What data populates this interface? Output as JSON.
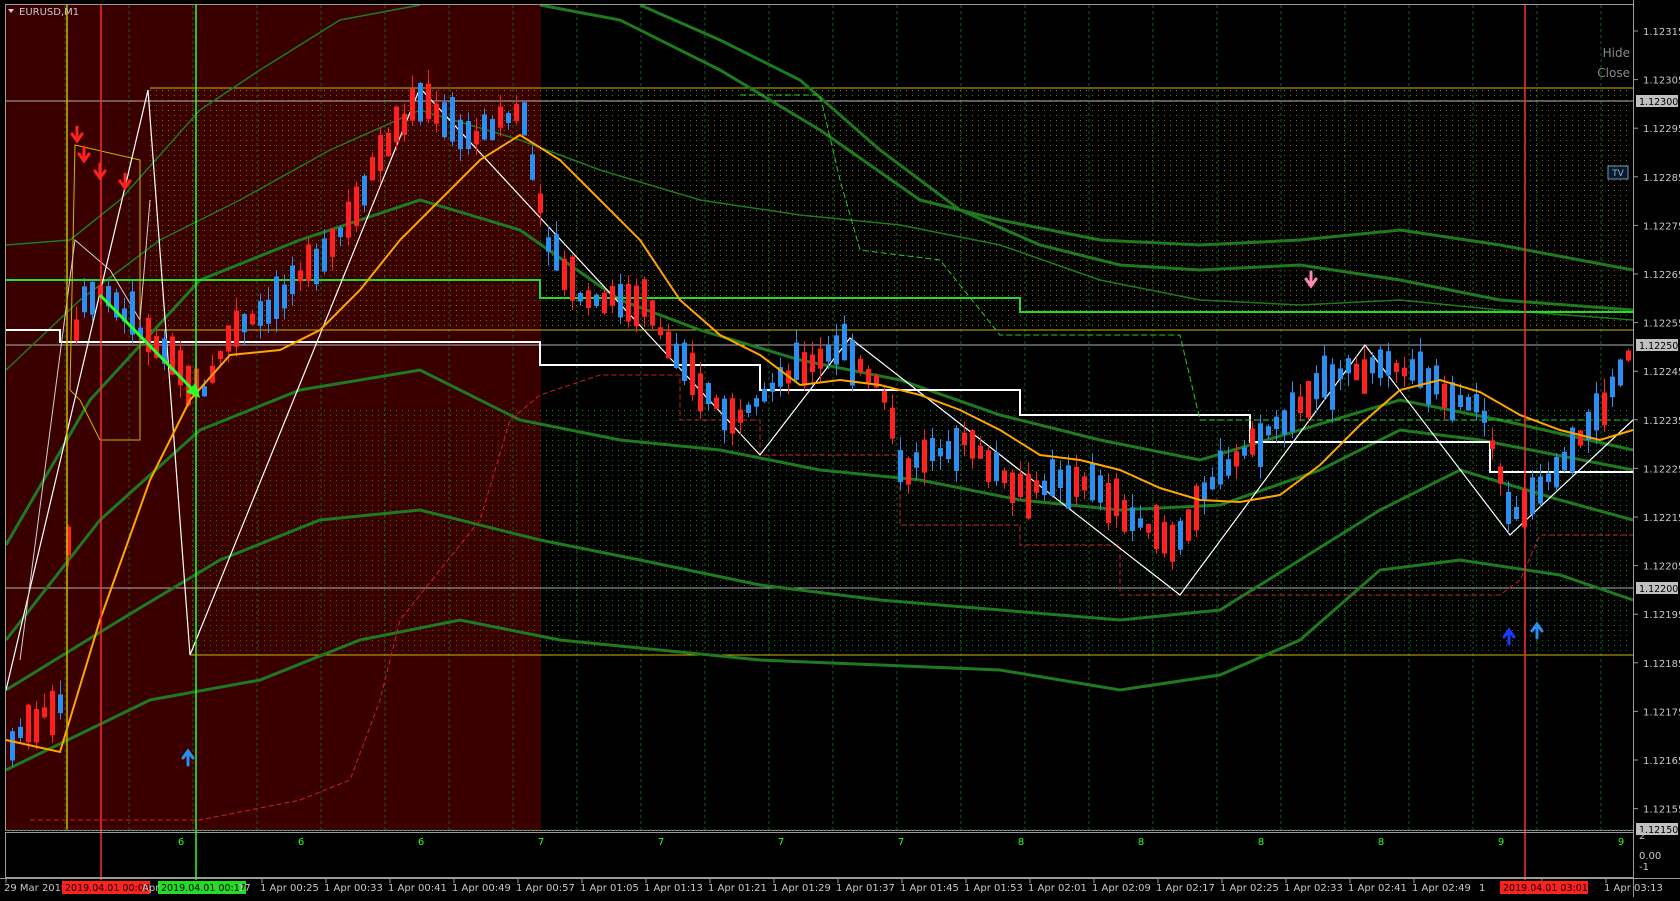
{
  "window": {
    "symbol_label": "EURUSD,M1"
  },
  "controls": {
    "hide_label": "Hide",
    "close_label": "Close",
    "tv_label": "TV"
  },
  "colors": {
    "background": "#000000",
    "shaded_region": "#3a0000",
    "bull_candle": "#2b8fef",
    "bear_candle": "#ff2020",
    "moving_average": "#ffa500",
    "envelope_band": "#1f7a1f",
    "level_line": "#22dd22",
    "pivot_line": "#ffffff",
    "session_line_red": "#ff2a2a",
    "session_line_green": "#2aff2a",
    "price_box_bg": "#c0c0c0"
  },
  "price_axis": {
    "ticks": [
      "1.12315",
      "1.12305",
      "1.12295",
      "1.12285",
      "1.12275",
      "1.12265",
      "1.12255",
      "1.12245",
      "1.12235",
      "1.12225",
      "1.12215",
      "1.12205",
      "1.12195",
      "1.12185",
      "1.12175",
      "1.12165",
      "1.12155"
    ],
    "boxed_prices": [
      "1.12300",
      "1.12250",
      "1.12200",
      "1.12150"
    ]
  },
  "indicator_axis": {
    "ticks": [
      "2",
      "0.00",
      "-1"
    ]
  },
  "subwindow_numbers": [
    "6",
    "6",
    "6",
    "7",
    "7",
    "7",
    "7",
    "8",
    "8",
    "8",
    "8",
    "9",
    "9"
  ],
  "time_axis": {
    "labels": [
      "29 Mar 2019",
      "1 Apr 00:25",
      "1 Apr 00:33",
      "1 Apr 00:41",
      "1 Apr 00:49",
      "1 Apr 00:57",
      "1 Apr 01:05",
      "1 Apr 01:13",
      "1 Apr 01:21",
      "1 Apr 01:29",
      "1 Apr 01:37",
      "1 Apr 01:45",
      "1 Apr 01:53",
      "1 Apr 02:01",
      "1 Apr 02:09",
      "1 Apr 02:17",
      "1 Apr 02:25",
      "1 Apr 02:33",
      "1 Apr 02:41",
      "1 Apr 02:49",
      "03:05",
      "1 Apr 03:13"
    ],
    "markers": [
      {
        "text": "2019.04.01 00:08",
        "color": "#ff2020"
      },
      {
        "text": "2019.04.01 00:17",
        "color": "#22dd22"
      },
      {
        "text": "2019.04.01 03:01",
        "color": "#ff2020"
      }
    ],
    "fragments": [
      "Apr",
      "17",
      "1"
    ]
  },
  "arrows": {
    "down_red": 4,
    "down_pink": 1,
    "up_blue": 3
  }
}
